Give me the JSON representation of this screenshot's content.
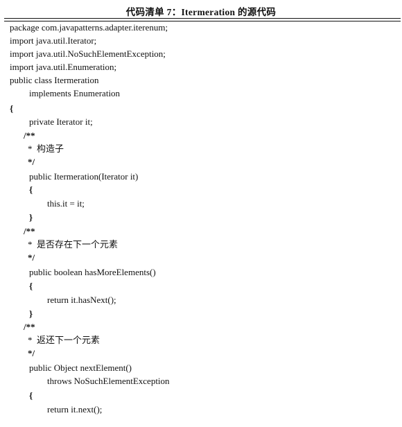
{
  "caption": "代码清单 7：Itermeration 的源代码",
  "lines": [
    {
      "text": "package com.javapatterns.adapter.iterenum;",
      "indent": 0
    },
    {
      "text": "import java.util.Iterator;",
      "indent": 0
    },
    {
      "text": "import java.util.NoSuchElementException;",
      "indent": 0
    },
    {
      "text": "import java.util.Enumeration;",
      "indent": 0
    },
    {
      "text": "public class Itermeration",
      "indent": 0
    },
    {
      "text": "implements Enumeration",
      "indent": 2
    },
    {
      "text": "{",
      "indent": 0
    },
    {
      "text": "private Iterator it;",
      "indent": 2
    },
    {
      "text": "/**",
      "indent": 1
    },
    {
      "text": "*  构造子",
      "indent": 1.2
    },
    {
      "text": "*/",
      "indent": 1.2
    },
    {
      "text": "public Itermeration(Iterator it)",
      "indent": 2
    },
    {
      "text": "{",
      "indent": 2
    },
    {
      "text": "this.it = it;",
      "indent": 3
    },
    {
      "text": "}",
      "indent": 2
    },
    {
      "text": "/**",
      "indent": 1
    },
    {
      "text": "*  是否存在下一个元素",
      "indent": 1.2
    },
    {
      "text": "*/",
      "indent": 1.2
    },
    {
      "text": "public boolean hasMoreElements()",
      "indent": 2
    },
    {
      "text": "{",
      "indent": 2
    },
    {
      "text": "return it.hasNext();",
      "indent": 3
    },
    {
      "text": "}",
      "indent": 2
    },
    {
      "text": "/**",
      "indent": 1
    },
    {
      "text": "*  返还下一个元素",
      "indent": 1.2
    },
    {
      "text": "*/",
      "indent": 1.2
    },
    {
      "text": "public Object nextElement()",
      "indent": 2
    },
    {
      "text": "throws NoSuchElementException",
      "indent": 3
    },
    {
      "text": "{",
      "indent": 2
    },
    {
      "text": "return it.next();",
      "indent": 3
    }
  ]
}
